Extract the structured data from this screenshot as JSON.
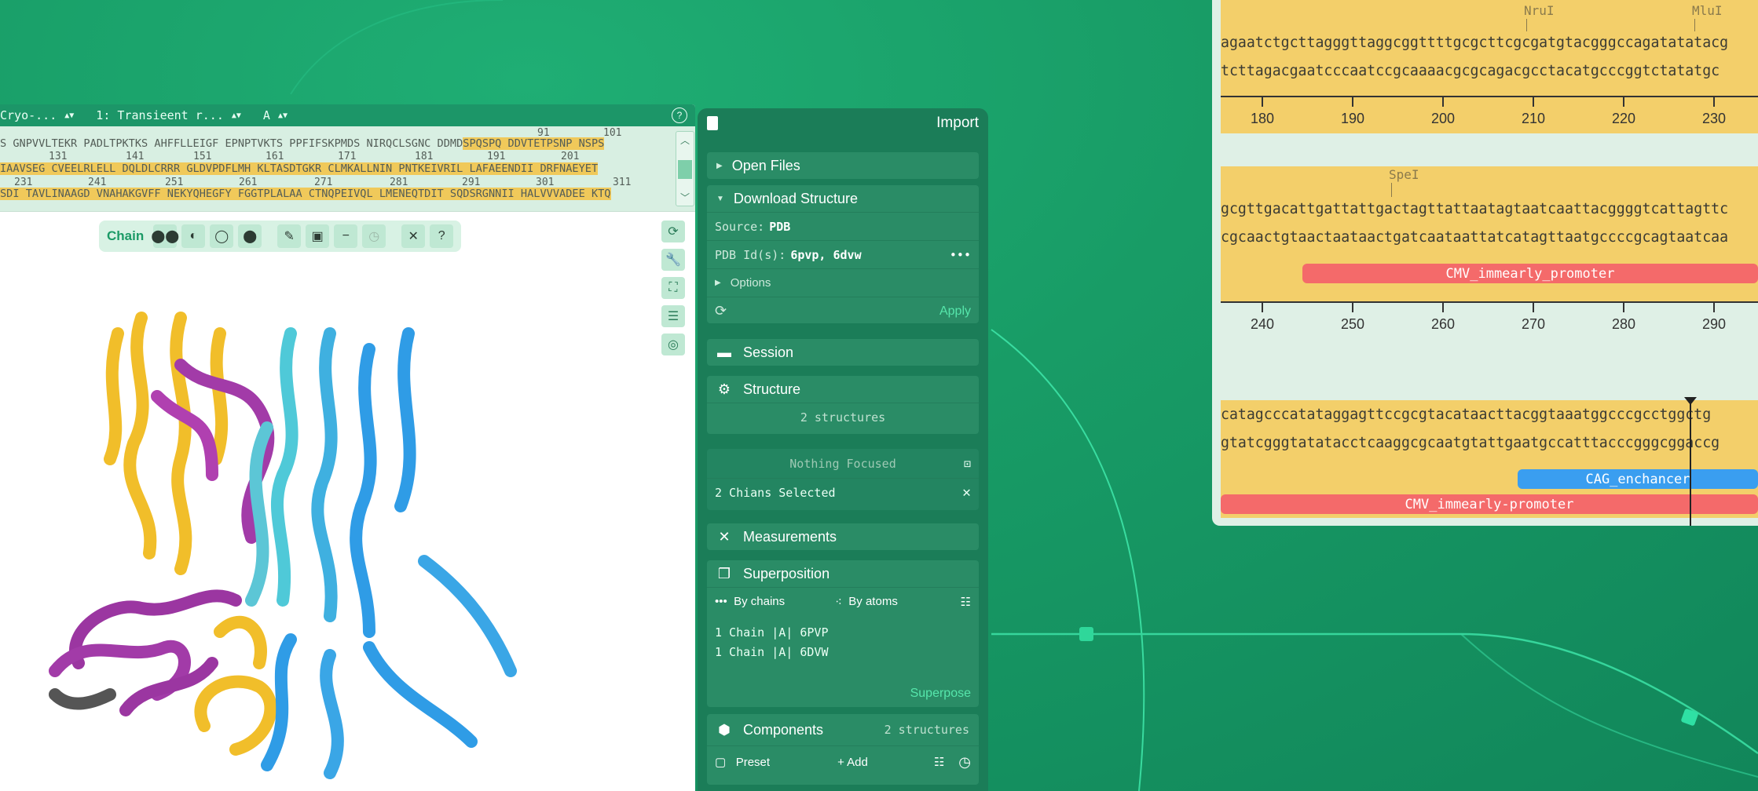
{
  "viewer": {
    "selectors": [
      "Cryo-...",
      "1: Transieent r...",
      "A"
    ],
    "help": "?",
    "seq_row1": "S GNPVVLTEKR PADLTPKTKS AHFFLLEIGF EPNPTVKTS PPFIFSKPMDS NIRQCLSGNC DDMD",
    "seq_row1_hl": "SPQSPQ DDVTETPSNP NSPS",
    "seq_row2_hl": "IAAVSEG CVEELRLELL DQLDLCRRR GLDVPDFLMH KLTASDTGKR CLMKALLNIN PNTKEIVRIL LAFAEENDII DRFNAEYET",
    "seq_row3": "SDI TAVLINAAGD VNAHAKGVFF NEKYQHEGFY FGGTPLALAA CTNQPEIVQL LMENEQTDIT SQDSRGNNII HALVVVADEE KTQ",
    "nums_row1": [
      "91",
      "101"
    ],
    "nums_row2": [
      "131",
      "141",
      "151",
      "161",
      "171",
      "181",
      "191",
      "201"
    ],
    "nums_row3": [
      "231",
      "241",
      "251",
      "261",
      "271",
      "281",
      "291",
      "301",
      "311"
    ],
    "toolbar_label": "Chain"
  },
  "panel": {
    "title": "Import",
    "open_files": "Open Files",
    "download_structure": "Download Structure",
    "source_label": "Source:",
    "source_value": "PDB",
    "pdb_label": "PDB Id(s):",
    "pdb_value": "6pvp, 6dvw",
    "more": "•••",
    "options": "Options",
    "apply": "Apply",
    "session": "Session",
    "structure": "Structure",
    "structure_count": "2 structures",
    "nothing_focused": "Nothing Focused",
    "chains_selected": "2 Chians Selected",
    "measurements": "Measurements",
    "superposition": "Superposition",
    "by_chains": "By chains",
    "by_atoms": "By atoms",
    "chain1": "1 Chain |A| 6PVP",
    "chain2": "1 Chain |A| 6DVW",
    "superpose": "Superpose",
    "components": "Components",
    "components_count": "2 structures",
    "preset": "Preset",
    "add": "+ Add"
  },
  "map": {
    "block1": {
      "top_seq": "agaatctgcttagggttaggcggttttgcgcttcgcgatgtacgggccagatatatacg",
      "bottom_seq": "tcttagacgaatcccaatccgcaaaacgcgcagacgcctacatgcccggtctatatgc",
      "enzymes": [
        "NruI",
        "MluI"
      ],
      "ticks": [
        "180",
        "190",
        "200",
        "210",
        "220",
        "230"
      ]
    },
    "block2": {
      "top_seq": "gcgttgacattgattattgactagttattaatagtaatcaattacggggtcattagttc",
      "bottom_seq": "cgcaactgtaactaataactgatcaataattatcatagttaatgccccgcagtaatcaa",
      "enzymes": [
        "SpeI"
      ],
      "feature": "CMV_immearly_promoter",
      "ticks": [
        "240",
        "250",
        "260",
        "270",
        "280",
        "290"
      ]
    },
    "block3": {
      "top_seq": "catagcccatataggagttccgcgtacataacttacggtaaatggcccgcctggctg",
      "bottom_seq": "gtatcgggtatatacctcaaggcgcaatgtattgaatgccatttacccgggcggaccg",
      "feature_blue": "CAG_enchancer",
      "feature_red": "CMV_immearly-promoter"
    },
    "colors": {
      "yellow": "#f3cf6a",
      "red": "#f46a6a",
      "blue": "#3a9ef0"
    }
  }
}
